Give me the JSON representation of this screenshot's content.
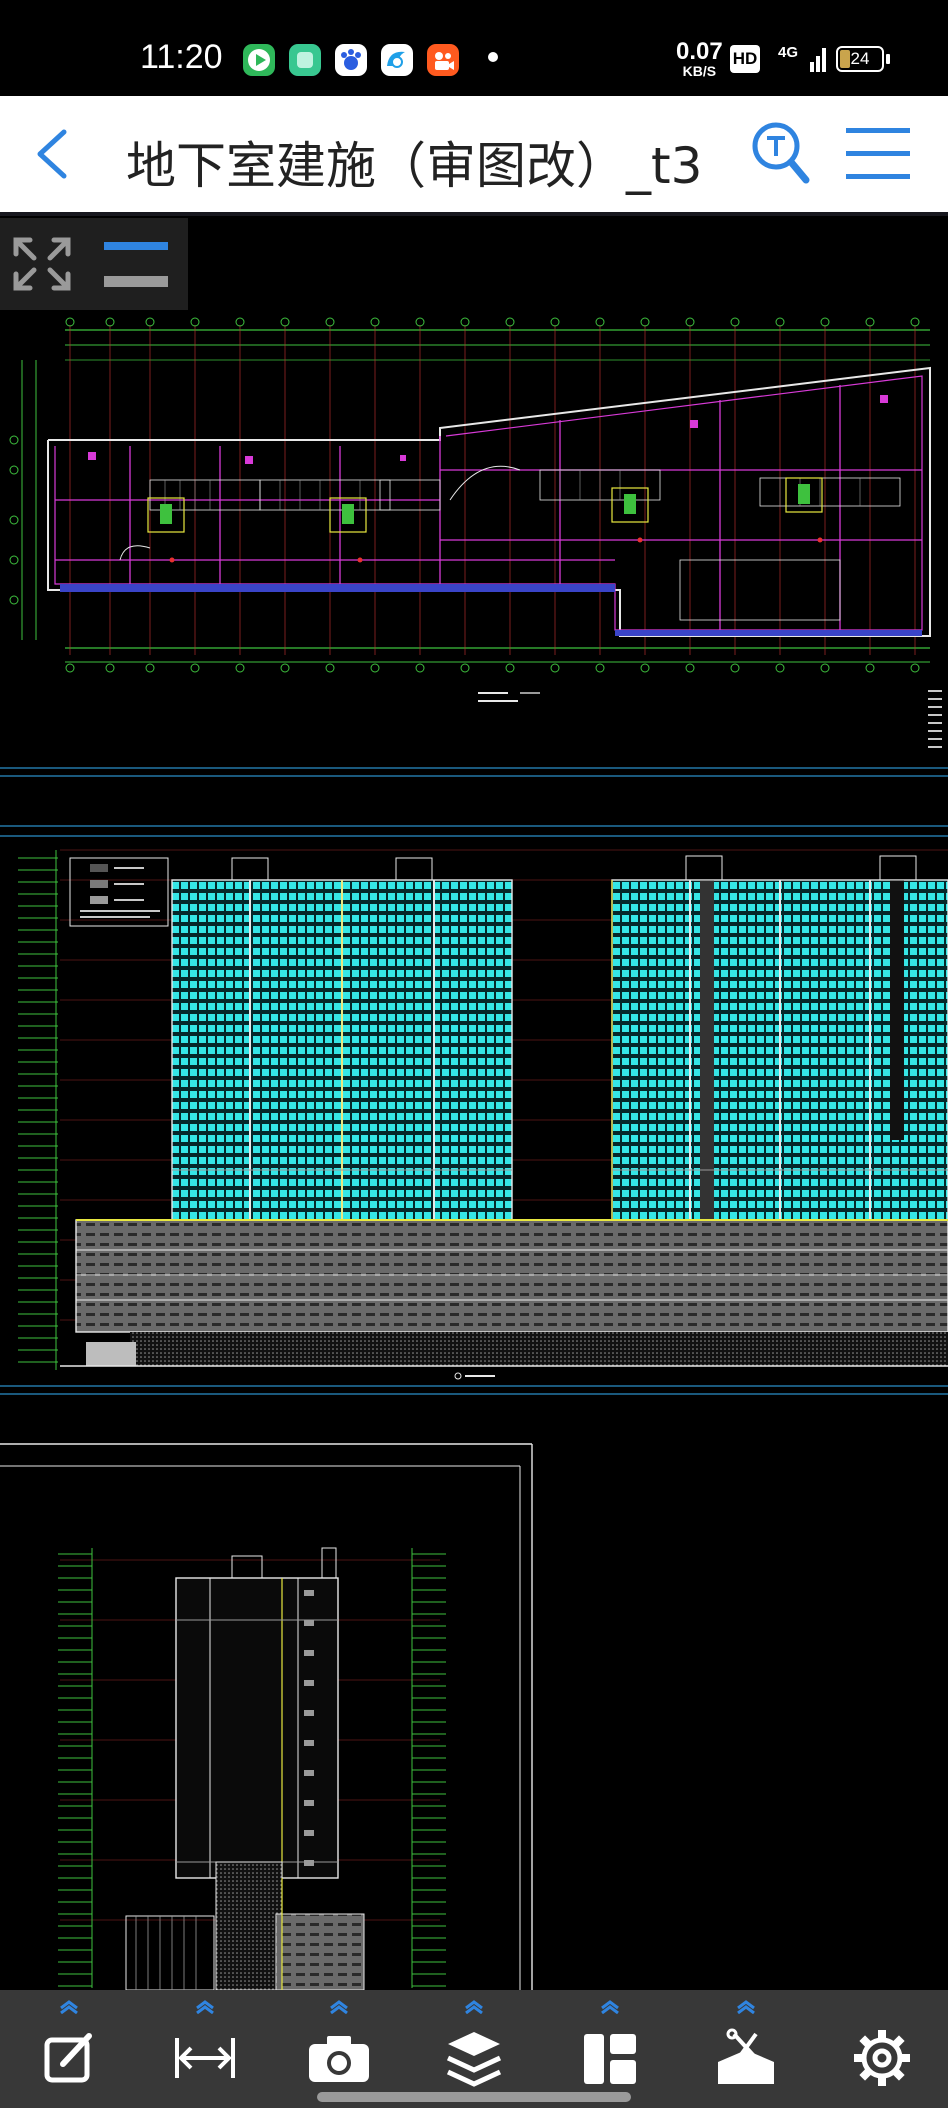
{
  "status_bar": {
    "time": "11:20",
    "speed_value": "0.07",
    "speed_unit": "KB/S",
    "hd_label": "HD",
    "network_label": "4G",
    "battery_level": "24",
    "app_icons": [
      "video-app-icon",
      "notes-app-icon",
      "baidu-app-icon",
      "browser-app-icon",
      "kuaishou-app-icon"
    ]
  },
  "header": {
    "title": "地下室建施（审图改）_t3",
    "back_icon": "chevron-left-icon",
    "search_icon": "text-search-icon",
    "menu_icon": "hamburger-menu-icon"
  },
  "floating_tools": {
    "fullscreen_icon": "fullscreen-expand-icon",
    "layer_toggle_icon": "layer-lines-icon"
  },
  "toolbar": {
    "items": [
      {
        "name": "annotate-tool",
        "icon": "edit-note-icon"
      },
      {
        "name": "measure-tool",
        "icon": "measure-distance-icon"
      },
      {
        "name": "screenshot-tool",
        "icon": "camera-icon"
      },
      {
        "name": "layers-tool",
        "icon": "layers-icon"
      },
      {
        "name": "layout-tool",
        "icon": "layout-icon"
      },
      {
        "name": "toolbox-tool",
        "icon": "toolbox-icon"
      },
      {
        "name": "settings-tool",
        "icon": "gear-icon"
      }
    ]
  },
  "colors": {
    "header_bg": "#ffffff",
    "accent_blue": "#2f84e0",
    "toolbar_bg": "#383838",
    "canvas_bg": "#000000",
    "cad_cyan": "#35e6e6",
    "cad_green": "#3ec13e",
    "cad_magenta": "#d83ad8",
    "cad_yellow": "#e8e840"
  }
}
